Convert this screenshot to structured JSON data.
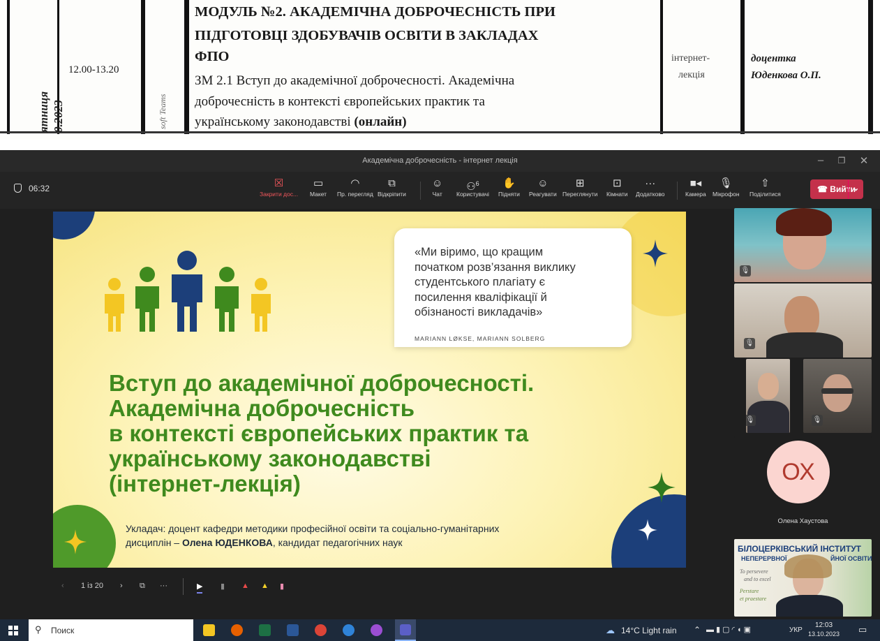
{
  "document": {
    "time": "12.00-13.20",
    "date_fragment_1": "ятниця",
    "date_fragment_2": "0.2023",
    "platform_fragment": "soft Teams",
    "module_title_1": "МОДУЛЬ №2.  АКАДЕМІЧНА ДОБРОЧЕСНІСТЬ ПРИ",
    "module_title_2": "ПІДГОТОВЦІ  ЗДОБУВАЧІВ  ОСВІТИ  В  ЗАКЛАДАХ",
    "module_title_3": "ФПО",
    "topic_1": "ЗМ 2.1  Вступ  до  академічної  доброчесності.  Академічна",
    "topic_2": "доброчесність    в    контексті    європейських    практик    та",
    "topic_3": "українському законодавстві",
    "topic_online": "(онлайн)",
    "format_1": "інтернет-",
    "format_2": "лекція",
    "lecturer_1": "доцентка",
    "lecturer_2": "Юденкова О.П."
  },
  "window": {
    "title": "Академічна доброчесність - інтернет лекція"
  },
  "toolbar": {
    "timer": "06:32",
    "buttons": [
      {
        "label": "Закрити дос...",
        "icon": "close-share-icon"
      },
      {
        "label": "Макет",
        "icon": "layout-icon"
      },
      {
        "label": "Пр. перегляд",
        "icon": "preview-icon"
      },
      {
        "label": "Відкріпити",
        "icon": "pop-out-icon"
      },
      {
        "label": "Чат",
        "icon": "chat-icon"
      },
      {
        "label": "Користувачі",
        "icon": "people-icon"
      },
      {
        "label": "Підняти",
        "icon": "raise-hand-icon"
      },
      {
        "label": "Реагувати",
        "icon": "react-icon"
      },
      {
        "label": "Переглянути",
        "icon": "view-icon"
      },
      {
        "label": "Кімнати",
        "icon": "rooms-icon"
      },
      {
        "label": "Додатково",
        "icon": "more-icon"
      },
      {
        "label": "Камера",
        "icon": "camera-icon"
      },
      {
        "label": "Мікрофон",
        "icon": "microphone-icon"
      },
      {
        "label": "Поділитися",
        "icon": "share-icon"
      }
    ],
    "participant_count": "6",
    "leave_label": "Вийти"
  },
  "slide": {
    "quote_1": "«Ми віримо, що кращим",
    "quote_2": "початком розв’язання виклику",
    "quote_3": "студентського плагіату є",
    "quote_4": "посилення кваліфікації й",
    "quote_5": "обізнаності викладачів»",
    "quote_author": "MARIANN LØKSE, MARIANN SOLBERG",
    "title_1": "Вступ до академічної доброчесності.",
    "title_2": "Академічна  доброчесність",
    "title_3": "в  контексті  європейських  практик та",
    "title_4": "українському законодавстві",
    "title_5": "(інтернет-лекція)",
    "author_prefix": "Укладач: доцент кафедри методики професійної освіти та соціально-гуманітарних",
    "author_line2_a": "дисциплін – ",
    "author_name": "Олена ЮДЕНКОВА",
    "author_line2_b": ", кандидат педагогічних наук",
    "brand_yellow": "#f3c623",
    "brand_green": "#3f8a1e",
    "brand_navy": "#1c3f7a"
  },
  "slide_nav": {
    "counter": "1 із 20"
  },
  "participants": {
    "initials": "ОХ",
    "name": "Олена Хаустова",
    "banner_1": "БІЛОЦЕРКІВСЬКИЙ ІНСТИТУТ",
    "banner_2": "НЕПЕРЕРВНОЇ",
    "banner_3": "ЙНОЇ ОСВІТИ",
    "banner_motto_1": "To persevere",
    "banner_motto_2": "and to excel",
    "banner_motto_3": "Perstare",
    "banner_motto_4": "et praestare"
  },
  "taskbar": {
    "search_placeholder": "Поиск",
    "weather": "14°C  Light rain",
    "language": "УКР",
    "time": "12:03",
    "date": "13.10.2023"
  }
}
